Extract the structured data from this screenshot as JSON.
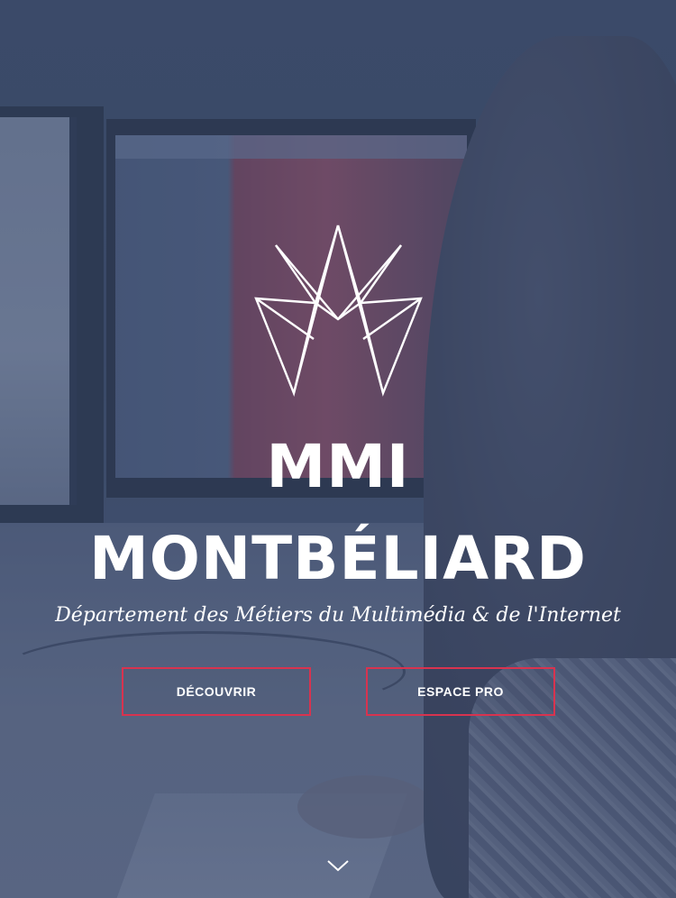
{
  "hero": {
    "logo_icon": "crown-logo-icon",
    "title_line1": "MMI",
    "title_line2": "MONTBÉLIARD",
    "subtitle": "Département des Métiers du Multimédia & de l'Internet"
  },
  "actions": {
    "discover_label": "DÉCOUVRIR",
    "pro_label": "ESPACE PRO"
  },
  "scroll": {
    "icon": "chevron-down-icon"
  },
  "colors": {
    "accent": "#d8334f",
    "overlay": "#324264",
    "text": "#ffffff"
  }
}
